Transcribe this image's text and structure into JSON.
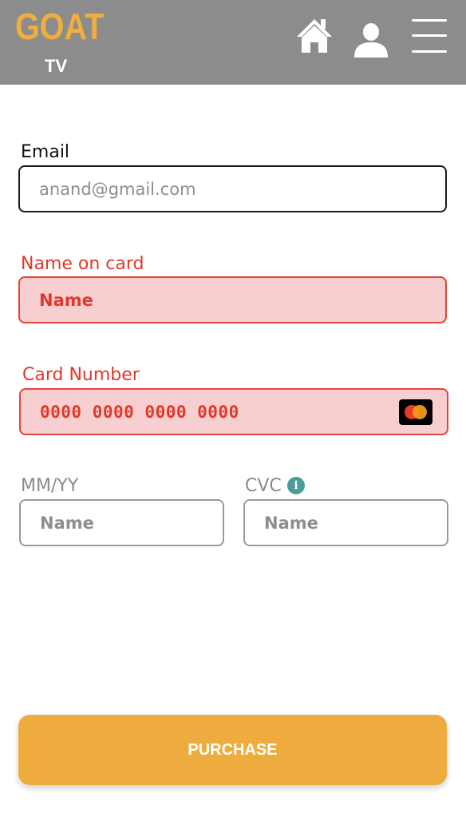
{
  "header": {
    "logo_main": "GOAT",
    "logo_sub": "TV",
    "icons": [
      "home-icon",
      "user-icon",
      "menu-icon"
    ],
    "background": "#8c8c8c",
    "logo_color": "#efae3e"
  },
  "form": {
    "email": {
      "label": "Email",
      "value": "anand@gmail.com"
    },
    "name_on_card": {
      "label": "Name on card",
      "value": "Name"
    },
    "card_number": {
      "label": "Card Number",
      "value": "0000 0000 0000 0000",
      "brand_icon": "mastercard-icon"
    },
    "expiry": {
      "label": "MM/YY",
      "value": "Name"
    },
    "cvc": {
      "label": "CVC",
      "value": "Name",
      "info_icon": "info-icon"
    }
  },
  "actions": {
    "purchase_label": "PURCHASE"
  },
  "colors": {
    "error": "#e0392b",
    "error_bg": "#f7cfd1",
    "accent": "#eeac3f",
    "info": "#4a9c9a"
  }
}
